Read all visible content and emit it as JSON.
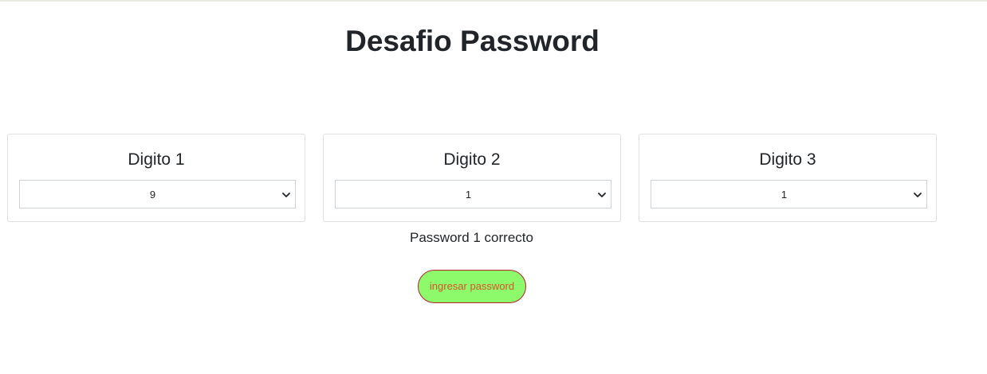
{
  "title": "Desafio Password",
  "digits": [
    {
      "label": "Digito 1",
      "value": "9"
    },
    {
      "label": "Digito 2",
      "value": "1"
    },
    {
      "label": "Digito 3",
      "value": "1"
    }
  ],
  "status": "Password 1 correcto",
  "button": {
    "label": "ingresar password",
    "bg_color": "#8dfa6c",
    "text_color": "#d9532b",
    "border_color": "#b3202a"
  },
  "icons": {
    "select_arrow": "chevron-down-icon"
  }
}
